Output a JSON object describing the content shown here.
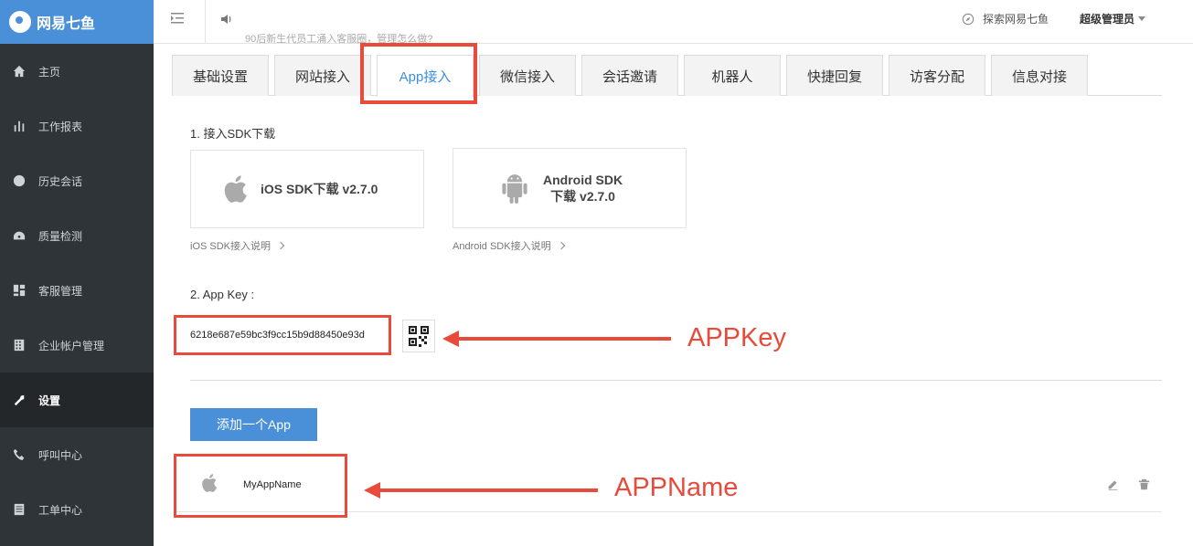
{
  "app": {
    "brand": "网易七鱼"
  },
  "sidebar": {
    "items": [
      {
        "label": "主页",
        "icon": "home-icon"
      },
      {
        "label": "工作报表",
        "icon": "bar-chart-icon"
      },
      {
        "label": "历史会话",
        "icon": "clock-icon"
      },
      {
        "label": "质量检测",
        "icon": "gauge-icon"
      },
      {
        "label": "客服管理",
        "icon": "dashboard-icon"
      },
      {
        "label": "企业帐户管理",
        "icon": "building-icon"
      },
      {
        "label": "设置",
        "icon": "wrench-icon",
        "active": true
      },
      {
        "label": "呼叫中心",
        "icon": "phone-icon"
      },
      {
        "label": "工单中心",
        "icon": "document-icon"
      }
    ]
  },
  "topbar": {
    "notice": "90后新生代员工涌入客服圈，管理怎么做?",
    "explore": "探索网易七鱼",
    "user": "超级管理员"
  },
  "tabs": [
    {
      "label": "基础设置"
    },
    {
      "label": "网站接入"
    },
    {
      "label": "App接入",
      "active": true
    },
    {
      "label": "微信接入"
    },
    {
      "label": "会话邀请"
    },
    {
      "label": "机器人"
    },
    {
      "label": "快捷回复"
    },
    {
      "label": "访客分配"
    },
    {
      "label": "信息对接"
    }
  ],
  "sdk": {
    "title": "1.  接入SDK下载",
    "ios_label": "iOS SDK下载 v2.7.0",
    "android_label_line1": "Android SDK",
    "android_label_line2": "下载 v2.7.0",
    "ios_link": "iOS SDK接入说明",
    "android_link": "Android SDK接入说明"
  },
  "appkey": {
    "title": "2.  App Key :",
    "value": "6218e687e59bc3f9cc15b9d88450e93d"
  },
  "add_button": "添加一个App",
  "app_list": [
    {
      "name": "MyAppName",
      "platform": "apple-icon"
    }
  ],
  "annotations": {
    "appkey": "APPKey",
    "appname": "APPName"
  },
  "colors": {
    "sidebar_bg": "#2f3438",
    "brand_blue": "#4a90d9",
    "tab_active_text": "#3b8ee0",
    "annotation_red": "#e84a3b"
  }
}
